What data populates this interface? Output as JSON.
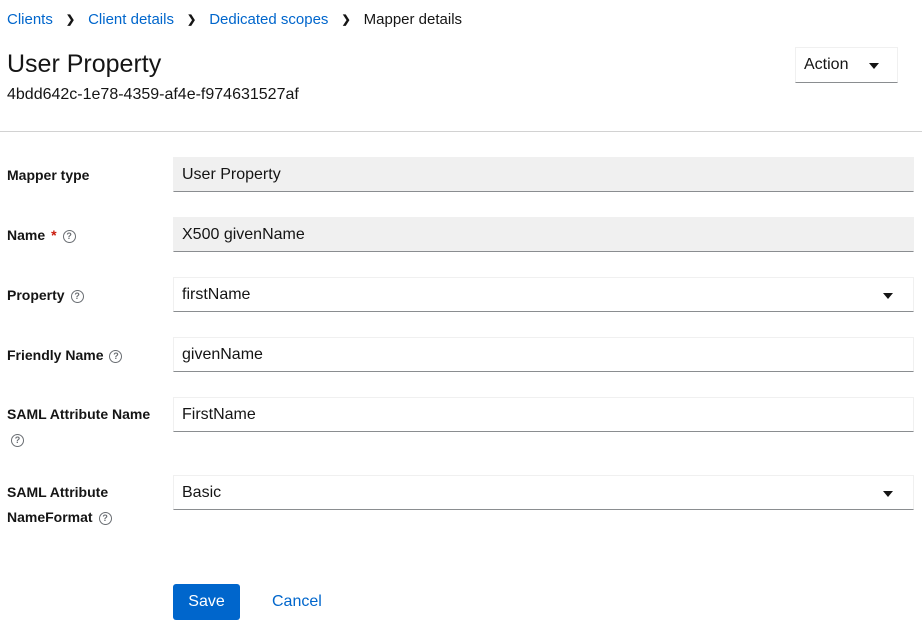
{
  "breadcrumb": [
    "Clients",
    "Client details",
    "Dedicated scopes",
    "Mapper details"
  ],
  "header": {
    "title": "User Property",
    "id": "4bdd642c-1e78-4359-af4e-f974631527af",
    "action_label": "Action"
  },
  "form": {
    "mapper_type": {
      "label": "Mapper type",
      "value": "User Property"
    },
    "name": {
      "label": "Name",
      "required": "*",
      "value": "X500 givenName"
    },
    "property": {
      "label": "Property",
      "value": "firstName"
    },
    "friendly_name": {
      "label": "Friendly Name",
      "value": "givenName"
    },
    "saml_attribute_name": {
      "label": "SAML Attribute Name",
      "value": "FirstName"
    },
    "saml_attribute_nameformat": {
      "label": "SAML Attribute NameFormat",
      "value": "Basic"
    }
  },
  "buttons": {
    "save": "Save",
    "cancel": "Cancel"
  },
  "help_glyph": "?"
}
